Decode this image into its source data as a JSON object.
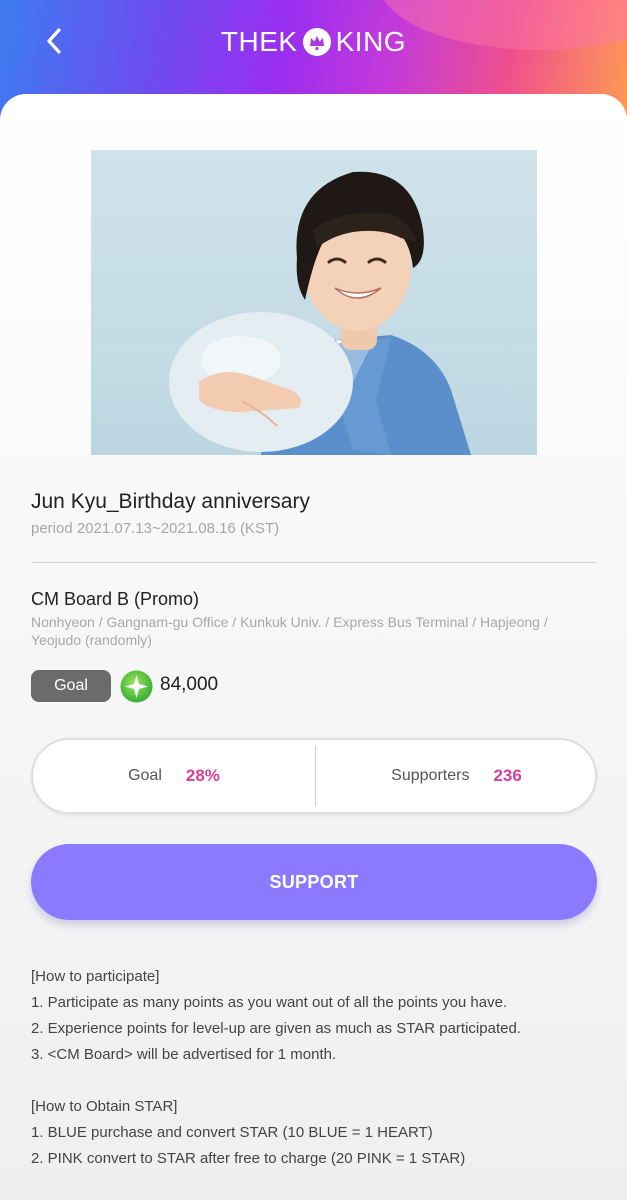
{
  "header": {
    "brand_left": "THEK",
    "brand_right": "KING",
    "back_icon": "chevron-left-icon"
  },
  "event": {
    "title": "Jun Kyu_Birthday anniversary",
    "period": "period 2021.07.13~2021.08.16 (KST)"
  },
  "board": {
    "name": "CM Board B (Promo)",
    "locations": "Nonhyeon / Gangnam-gu Office / Kunkuk Univ. / Express Bus Terminal / Hapjeong / Yeojudo (randomly)"
  },
  "goal": {
    "badge_label": "Goal",
    "value": "84,000",
    "icon": "green-star-icon"
  },
  "stats": {
    "goal_label": "Goal",
    "goal_value": "28%",
    "supporters_label": "Supporters",
    "supporters_value": "236"
  },
  "support_button": "SUPPORT",
  "participate": {
    "heading": "[How to participate]",
    "items": [
      "1. Participate as many points as you want out of all the points you have.",
      "2. Experience points for level-up are given as much as STAR participated.",
      "3. <CM Board> will be advertised for 1 month."
    ]
  },
  "obtain": {
    "heading": "[How to Obtain STAR]",
    "items": [
      "1. BLUE purchase and convert STAR (10 BLUE = 1 HEART)",
      "2. PINK convert to STAR after free to charge (20 PINK = 1 STAR)"
    ]
  },
  "colors": {
    "accent_purple": "#8b7aff",
    "stat_pink": "#d63f9c",
    "badge_gray": "#6b6b6b"
  }
}
